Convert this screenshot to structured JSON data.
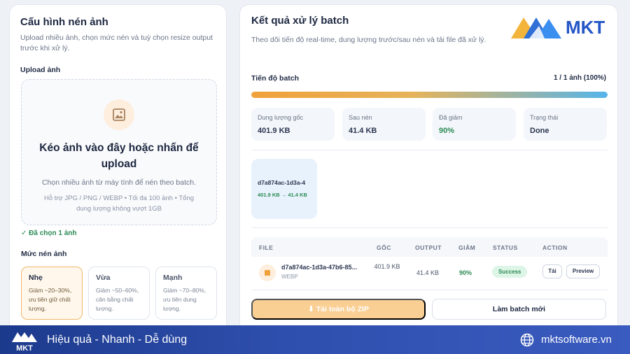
{
  "left": {
    "title": "Cấu hình nén ảnh",
    "subtitle": "Upload nhiều ảnh, chọn mức nén và tuỳ chọn resize output trước khi xử lý.",
    "upload_label": "Upload ảnh",
    "upload_icon": "image-icon",
    "drop_title": "Kéo ảnh vào đây hoặc nhấn để upload",
    "drop_sub": "Chọn nhiều ảnh từ máy tính để nén theo batch.",
    "drop_hint": "Hỗ trợ JPG / PNG / WEBP • Tối đa 100 ảnh • Tổng dung lượng không vượt 1GB",
    "selected": "✓ Đã chọn 1 ảnh",
    "level_label": "Mức nén ảnh",
    "options": [
      {
        "name": "Nhẹ",
        "desc": "Giảm ~20–30%, ưu tiên giữ chất lượng."
      },
      {
        "name": "Vừa",
        "desc": "Giảm ~50–60%, cân bằng chất lượng."
      },
      {
        "name": "Mạnh",
        "desc": "Giảm ~70–80%, ưu tiên dung lượng."
      }
    ]
  },
  "right": {
    "title": "Kết quả xử lý batch",
    "subtitle": "Theo dõi tiến độ real-time, dung lượng trước/sau nén và tải file đã xử lý.",
    "logo_text": "MKT",
    "progress_label": "Tiến độ batch",
    "progress_count": "1 / 1 ảnh (100%)",
    "progress": 1.0,
    "stats": [
      {
        "label": "Dung lượng gốc",
        "value": "401.9 KB"
      },
      {
        "label": "Sau nén",
        "value": "41.4 KB"
      },
      {
        "label": "Đã giảm",
        "value": "90%"
      },
      {
        "label": "Trạng thái",
        "value": "Done"
      }
    ],
    "thumb": {
      "name": "d7a874ac-1d3a-4",
      "size": "401.9 KB → 41.4 KB"
    },
    "table": {
      "headers": [
        "FILE",
        "GỐC",
        "OUTPUT",
        "GIẢM",
        "STATUS",
        "ACTION"
      ],
      "row": {
        "name": "d7a874ac-1d3a-47b6-85...",
        "format": "WEBP",
        "original": "401.9 KB",
        "output": "41.4 KB",
        "reduced": "90%",
        "status": "Success",
        "download": "Tải",
        "preview": "Preview"
      }
    },
    "zip_button": "⬇ Tải toàn bộ ZIP",
    "new_batch_button": "Làm batch mới"
  },
  "footer": {
    "logo_text": "MKT",
    "slogan": "Hiệu quả - Nhanh - Dễ dùng",
    "site": "mktsoftware.vn"
  },
  "colors": {
    "accent": "#f0a13a",
    "success": "#2c8a55",
    "footer": "#2f4fae"
  }
}
